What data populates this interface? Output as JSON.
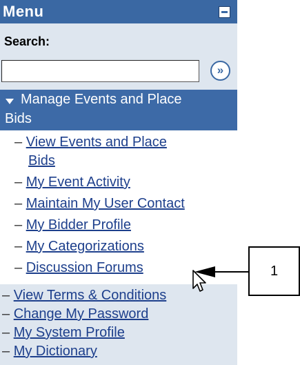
{
  "menu": {
    "title": "Menu",
    "collapse_icon": "minus-icon"
  },
  "search": {
    "label": "Search:",
    "value": "",
    "go_icon": "double-chevron-right-icon",
    "go_glyph": "»"
  },
  "active_section": {
    "line1": "Manage Events and Place",
    "line2": "Bids",
    "icon": "triangle-down-icon"
  },
  "sub_items": [
    {
      "dash": "–",
      "label": "View Events and Place",
      "label_cont": "Bids"
    },
    {
      "dash": "–",
      "label": "My Event Activity"
    },
    {
      "dash": "–",
      "label": "Maintain My User Contact"
    },
    {
      "dash": "–",
      "label": "My Bidder Profile"
    },
    {
      "dash": "–",
      "label": "My Categorizations"
    },
    {
      "dash": "–",
      "label": "Discussion Forums"
    }
  ],
  "bottom_items": [
    {
      "dash": "–",
      "label": "View Terms & Conditions"
    },
    {
      "dash": "–",
      "label": "Change My Password"
    },
    {
      "dash": "–",
      "label": "My System Profile"
    },
    {
      "dash": "–",
      "label": "My Dictionary"
    }
  ],
  "callout": {
    "number": "1"
  },
  "colors": {
    "header_blue": "#3a68a3",
    "panel_light": "#dee6ef",
    "link": "#1d3f8c"
  }
}
